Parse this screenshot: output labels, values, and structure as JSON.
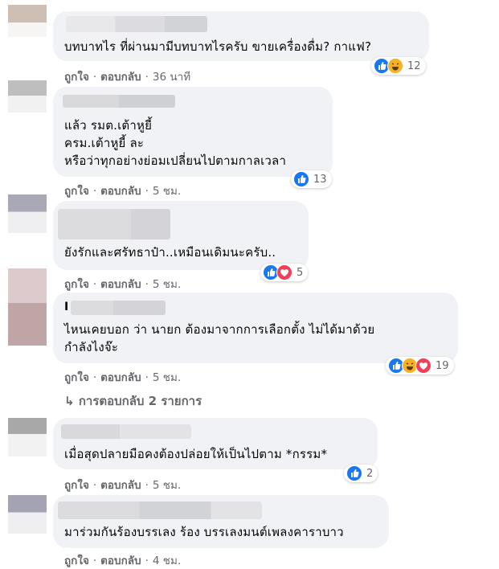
{
  "comments": [
    {
      "text_lines": [
        "บทบาทไร ที่ผ่านมามีบทบาทไรครับ ขายเครื่องดื่ม? กาแฟ?"
      ],
      "reactions": [
        "like-icon",
        "haha-icon"
      ],
      "reaction_count": "12",
      "like_label": "ถูกใจ",
      "reply_label": "ตอบกลับ",
      "time": "36 นาที"
    },
    {
      "text_lines": [
        "แล้ว รมต.เต้าหูยี้",
        "ครม.เต้าหูยี้ ละ",
        "หรือว่าทุกอย่างย่อมเปลี่ยนไปตามกาลเวลา"
      ],
      "reactions": [
        "like-icon"
      ],
      "reaction_count": "13",
      "like_label": "ถูกใจ",
      "reply_label": "ตอบกลับ",
      "time": "5 ชม."
    },
    {
      "text_lines": [
        "ยังรักและศรัทธาป๋า..เหมือนเดิมนะครับ.."
      ],
      "reactions": [
        "like-icon",
        "love-icon"
      ],
      "reaction_count": "5",
      "like_label": "ถูกใจ",
      "reply_label": "ตอบกลับ",
      "time": "5 ชม."
    },
    {
      "name_fragment": "I",
      "text_lines": [
        "ไหนเคยบอก ว่า นายก ต้องมาจากการเลือกตั้ง ไม่ได้มาด้วย",
        "กำลังไงจ๊ะ"
      ],
      "reactions": [
        "like-icon",
        "haha-icon",
        "love-icon"
      ],
      "reaction_count": "19",
      "like_label": "ถูกใจ",
      "reply_label": "ตอบกลับ",
      "time": "5 ชม.",
      "replies_label": "การตอบกลับ 2 รายการ"
    },
    {
      "text_lines": [
        "เมื่อสุดปลายมือคงต้องปล่อยให้เป็นไปตาม *กรรม*"
      ],
      "reactions": [
        "like-icon"
      ],
      "reaction_count": "2",
      "like_label": "ถูกใจ",
      "reply_label": "ตอบกลับ",
      "time": "5 ชม."
    },
    {
      "text_lines": [
        "มาร่วมกันร้องบรรเลง ร้อง บรรเลงมนต์เพลงคาราบาว"
      ],
      "reactions": [],
      "reaction_count": "",
      "like_label": "ถูกใจ",
      "reply_label": "ตอบกลับ",
      "time": "4 ชม."
    }
  ],
  "colors": {
    "bubble": "#f0f2f5",
    "meta_text": "#65676b",
    "like": "#1877f2",
    "haha": "#f7b125",
    "love": "#f33e58"
  }
}
